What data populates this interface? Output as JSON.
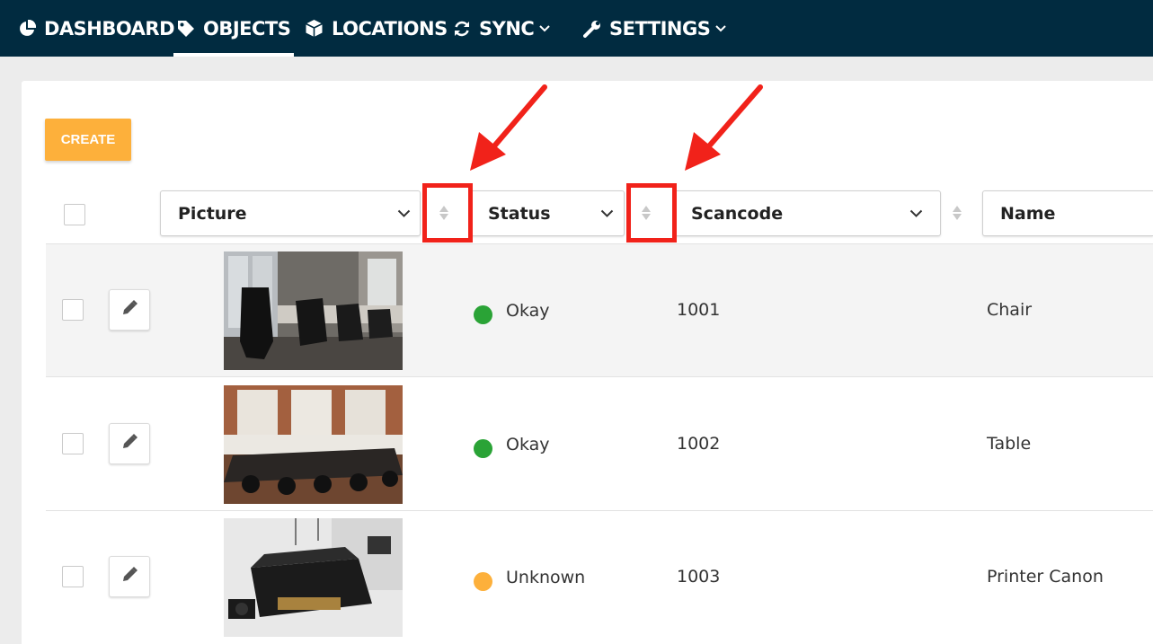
{
  "nav": {
    "items": [
      {
        "label": "DASHBOARD",
        "icon": "pie-chart-icon"
      },
      {
        "label": "OBJECTS",
        "icon": "tag-icon",
        "active": true
      },
      {
        "label": "LOCATIONS",
        "icon": "cube-icon"
      },
      {
        "label": "SYNC",
        "icon": "refresh-icon",
        "dropdown": true
      },
      {
        "label": "SETTINGS",
        "icon": "wrench-icon",
        "dropdown": true
      }
    ]
  },
  "toolbar": {
    "create_label": "CREATE"
  },
  "table": {
    "columns": [
      {
        "label": "Picture"
      },
      {
        "label": "Status"
      },
      {
        "label": "Scancode"
      },
      {
        "label": "Name"
      }
    ],
    "rows": [
      {
        "status": "Okay",
        "status_color": "#2aa336",
        "scancode": "1001",
        "name": "Chair",
        "picture": "office-chairs-photo"
      },
      {
        "status": "Okay",
        "status_color": "#2aa336",
        "scancode": "1002",
        "name": "Table",
        "picture": "conference-table-photo"
      },
      {
        "status": "Unknown",
        "status_color": "#fdb03b",
        "scancode": "1003",
        "name": "Printer Canon",
        "picture": "printer-photo"
      }
    ]
  },
  "colors": {
    "nav_bg": "#012b40",
    "accent": "#fdb03b",
    "annotation": "#f1221a",
    "ok": "#2aa336",
    "unknown": "#fdb03b"
  }
}
